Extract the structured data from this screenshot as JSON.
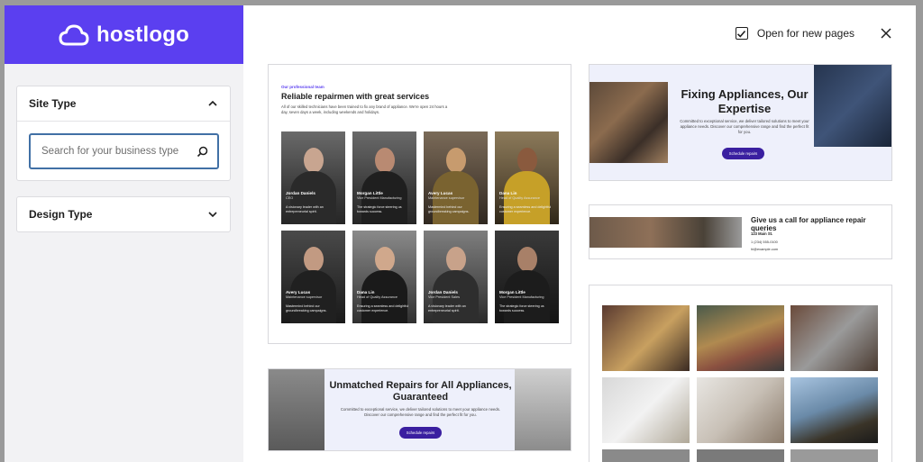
{
  "brand": {
    "name": "hostlogo"
  },
  "sidebar": {
    "site_type": {
      "label": "Site Type",
      "search_placeholder": "Search for your business type"
    },
    "design_type": {
      "label": "Design Type"
    }
  },
  "topbar": {
    "open_new_pages_label": "Open for new pages",
    "open_new_pages_checked": true
  },
  "cards": {
    "team": {
      "kicker": "Our professional team",
      "title": "Reliable repairmen with great services",
      "desc": "All of our skilled technicians have been trained to fix any brand of appliance. We're open 24 hours a day, seven days a week, including weekends and holidays.",
      "people": [
        {
          "name": "Jordan Daniels",
          "role": "CEO",
          "desc": "A visionary leader with an entrepreneurial spirit."
        },
        {
          "name": "Morgan Little",
          "role": "Vice President Manufacturing",
          "desc": "The strategic force steering us towards success."
        },
        {
          "name": "Avery Lucas",
          "role": "Maintenance supervisor",
          "desc": "Mastermind behind our groundbreaking campaigns."
        },
        {
          "name": "Dana Lin",
          "role": "Head of Quality Assurance",
          "desc": "Ensuring a seamless and delightful customer experience."
        },
        {
          "name": "Avery Lucas",
          "role": "Maintenance supervisor",
          "desc": "Mastermind behind our groundbreaking campaigns."
        },
        {
          "name": "Dana Lin",
          "role": "Head of Quality Assurance",
          "desc": "Ensuring a seamless and delightful customer experience."
        },
        {
          "name": "Jordan Daniels",
          "role": "Vice President Sales",
          "desc": "A visionary leader with an entrepreneurial spirit."
        },
        {
          "name": "Morgan Little",
          "role": "Vice President Manufacturing",
          "desc": "The strategic force steering us towards success."
        }
      ]
    },
    "hero": {
      "title": "Fixing Appliances, Our Expertise",
      "desc": "Committed to exceptional service, we deliver tailored solutions to meet your appliance needs. Discover our comprehensive range and find the perfect fit for you.",
      "button": "Schedule repairs"
    },
    "contact": {
      "title": "Give us a call for appliance repair queries",
      "address": "123 Main St.",
      "phone": "1 (234) 555-0100",
      "email": "hi@example.com"
    },
    "guarantee": {
      "title": "Unmatched Repairs for All Appliances, Guaranteed",
      "desc": "Committed to exceptional service, we deliver tailored solutions to meet your appliance needs. Discover our comprehensive range and find the perfect fit for you.",
      "button": "Schedule repairs"
    }
  },
  "colors": {
    "brand": "#5b3ff0",
    "button": "#3a1fa0",
    "focus": "#4170a5"
  }
}
